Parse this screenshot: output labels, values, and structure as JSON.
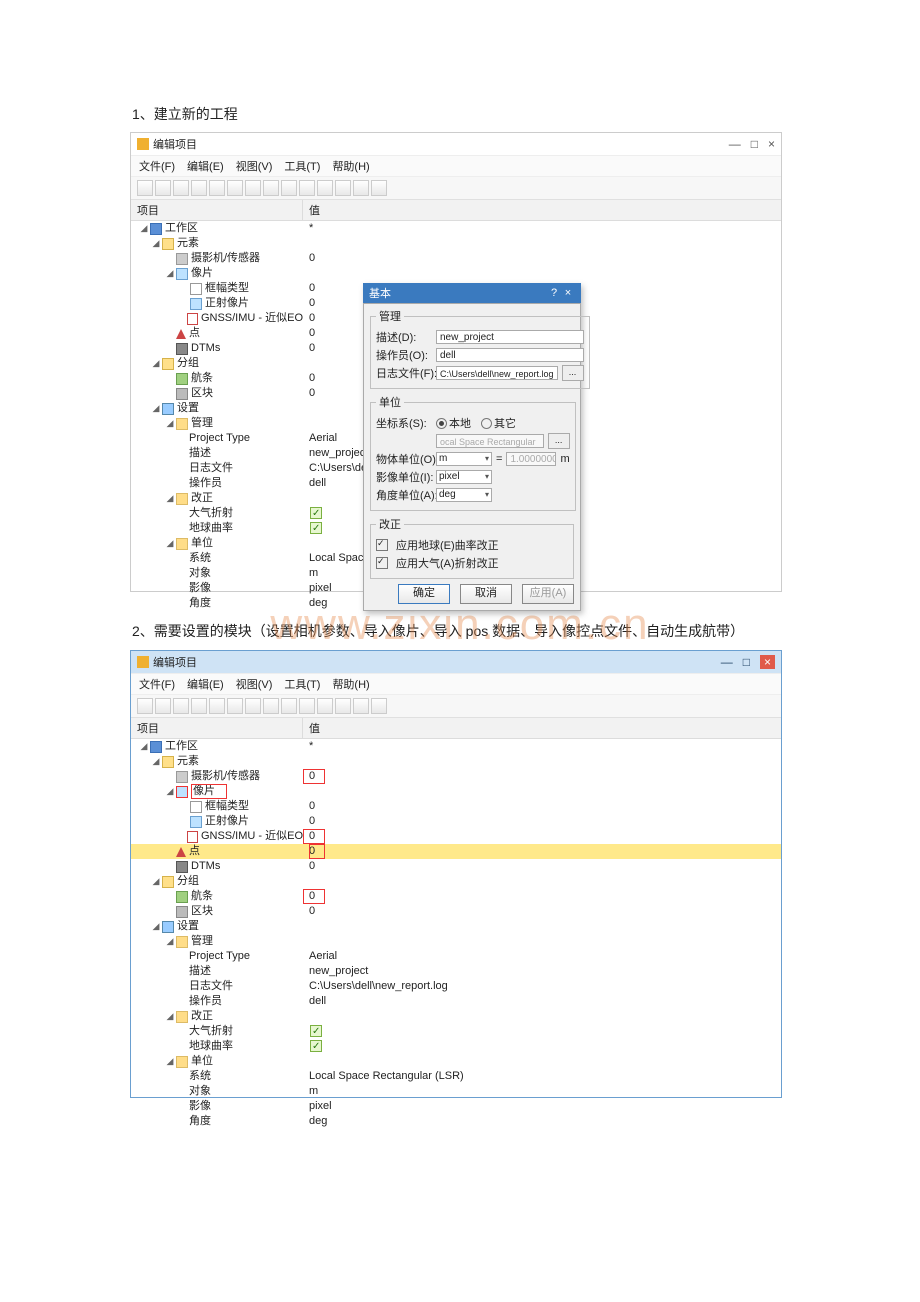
{
  "doc": {
    "section1_title": "1、建立新的工程",
    "section2_title": "2、需要设置的模块（设置相机参数、导入像片、导入 pos 数据、导入像控点文件、自动生成航带）",
    "watermark": "www.zixin.com.cn"
  },
  "app": {
    "title": "编辑项目",
    "menus": {
      "file": "文件(F)",
      "edit": "编辑(E)",
      "view": "视图(V)",
      "tool": "工具(T)",
      "help": "帮助(H)"
    },
    "headers": {
      "item": "项目",
      "value": "值"
    },
    "winctl": {
      "min": "—",
      "max": "□",
      "close": "×"
    }
  },
  "tree": {
    "workspace": "工作区",
    "workspace_val": "*",
    "elements": "元素",
    "camera": "摄影机/传感器",
    "camera_val": "0",
    "images": "像片",
    "frame": "框幅类型",
    "frame_val": "0",
    "ortho": "正射像片",
    "ortho_val": "0",
    "gnss": "GNSS/IMU - 近似EO",
    "gnss_val": "0",
    "points": "点",
    "points_val": "0",
    "dtms": "DTMs",
    "dtms_val": "0",
    "groups": "分组",
    "strips": "航条",
    "strips_val": "0",
    "blocks": "区块",
    "blocks_val": "0",
    "settings": "设置",
    "manage": "管理",
    "ptype": "Project Type",
    "ptype_val": "Aerial",
    "desc": "描述",
    "desc_val": "new_project",
    "logf": "日志文件",
    "logf_val": "C:\\Users\\dell\\",
    "logf_val2": "C:\\Users\\dell\\new_report.log",
    "oper": "操作员",
    "oper_val": "dell",
    "correct": "改正",
    "atmos": "大气折射",
    "earth": "地球曲率",
    "units": "单位",
    "system": "系统",
    "system_val": "Local Space R",
    "system_val2": "Local Space Rectangular (LSR)",
    "object": "对象",
    "object_val": "m",
    "image": "影像",
    "image_val": "pixel",
    "angle": "角度",
    "angle_val": "deg"
  },
  "dialog": {
    "title": "基本",
    "help": "?",
    "close": "×",
    "mgmt": "管理",
    "desc_lab": "描述(D):",
    "desc_val": "new_project",
    "oper_lab": "操作员(O):",
    "oper_val": "dell",
    "log_lab": "日志文件(F):",
    "log_val": "C:\\Users\\dell\\new_report.log",
    "log_btn": "...",
    "unit": "单位",
    "coord_lab": "坐标系(S):",
    "coord_local": "本地",
    "coord_other": "其它",
    "coord_val": "ocal Space Rectangular (LSR)",
    "coord_btn": "...",
    "obj_lab": "物体单位(O):",
    "obj_val": "m",
    "eq": "=",
    "obj_num": "1.00000000",
    "obj_m": "m",
    "img_lab": "影像单位(I):",
    "img_val": "pixel",
    "ang_lab": "角度单位(A):",
    "ang_val": "deg",
    "corr": "改正",
    "earth_cb": "应用地球(E)曲率改正",
    "atmos_cb": "应用大气(A)折射改正",
    "ok": "确定",
    "cancel": "取消",
    "apply": "应用(A)"
  }
}
